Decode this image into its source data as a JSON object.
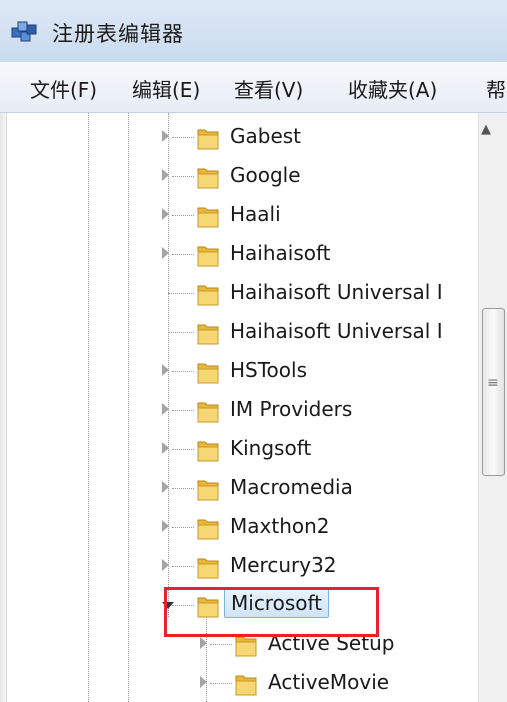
{
  "window": {
    "title": "注册表编辑器",
    "icon": "registry-editor-icon"
  },
  "menu": [
    {
      "label": "文件(F)"
    },
    {
      "label": "编辑(E)"
    },
    {
      "label": "查看(V)"
    },
    {
      "label": "收藏夹(A)"
    },
    {
      "label": "帮"
    }
  ],
  "tree": {
    "items": [
      {
        "label": "Gabest",
        "expandable": true
      },
      {
        "label": "Google",
        "expandable": true
      },
      {
        "label": "Haali",
        "expandable": true
      },
      {
        "label": "Haihaisoft",
        "expandable": true
      },
      {
        "label": "Haihaisoft Universal I",
        "expandable": false
      },
      {
        "label": "Haihaisoft Universal I",
        "expandable": false
      },
      {
        "label": "HSTools",
        "expandable": true
      },
      {
        "label": "IM Providers",
        "expandable": true
      },
      {
        "label": "Kingsoft",
        "expandable": true
      },
      {
        "label": "Macromedia",
        "expandable": true
      },
      {
        "label": "Maxthon2",
        "expandable": true
      },
      {
        "label": "Mercury32",
        "expandable": true
      },
      {
        "label": "Microsoft",
        "expandable": true,
        "expanded": true,
        "selected": true
      },
      {
        "label": "Active Setup",
        "expandable": true,
        "child": true
      },
      {
        "label": "ActiveMovie",
        "expandable": true,
        "child": true
      }
    ]
  },
  "colors": {
    "highlight_box": "#e8222a",
    "selection": "#cfe4f8",
    "folder": "#f2c94c"
  }
}
